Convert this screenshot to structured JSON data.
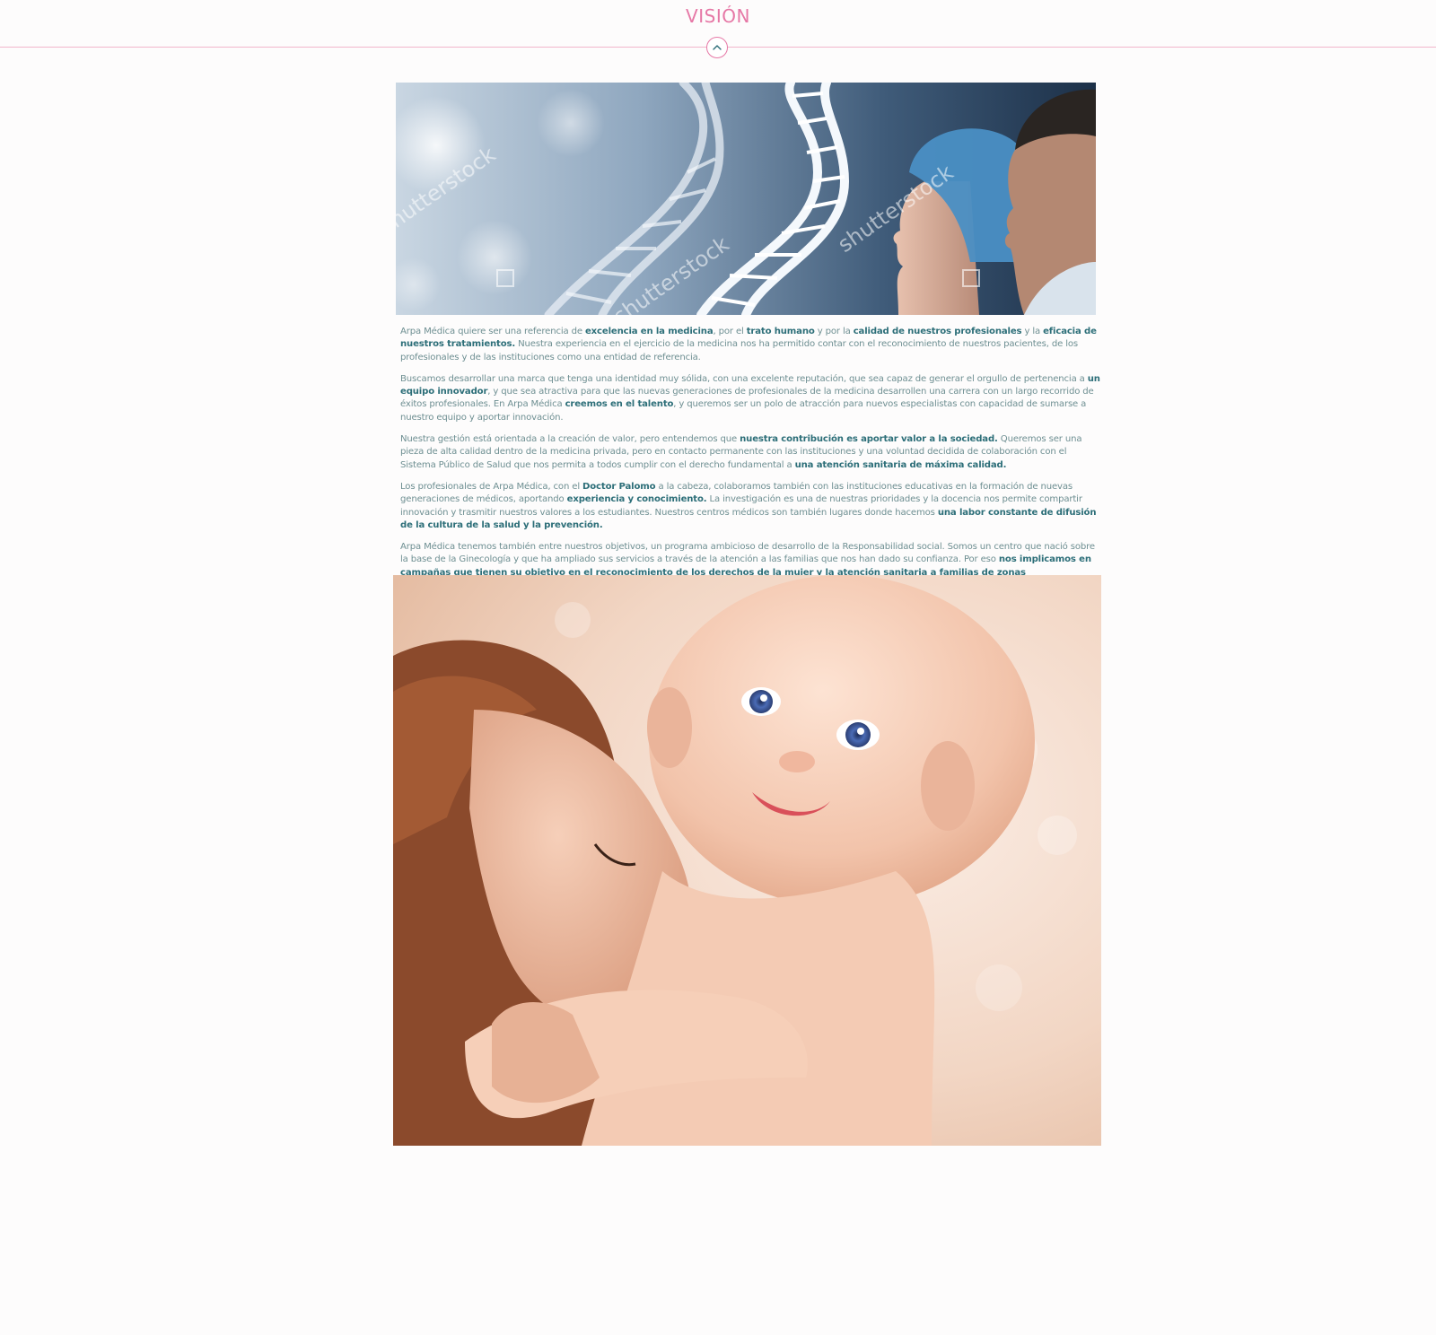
{
  "section": {
    "title": "VISIÓN",
    "collapse_icon": "chevron-up-icon"
  },
  "colors": {
    "title_pink": "#e678a6",
    "divider_pink": "#f2b6cc",
    "text_teal": "#6e8f92",
    "bold_teal": "#2c6e78"
  },
  "banner_image": {
    "subject": "DNA helix with medical professionals",
    "watermark": "shutterstock"
  },
  "family_image": {
    "subject": "mother hugging smiling baby"
  },
  "paragraphs": [
    [
      {
        "t": "Arpa Médica quiere ser una referencia de "
      },
      {
        "t": "excelencia en la medicina",
        "b": true
      },
      {
        "t": ", por el "
      },
      {
        "t": "trato humano",
        "b": true
      },
      {
        "t": " y por la "
      },
      {
        "t": "calidad de nuestros profesionales",
        "b": true
      },
      {
        "t": " y la "
      },
      {
        "t": "eficacia de nuestros tratamientos.",
        "b": true
      },
      {
        "t": " Nuestra experiencia en el ejercicio de la medicina nos ha permitido contar con el reconocimiento de nuestros pacientes, de los profesionales y de las instituciones como una entidad de referencia."
      }
    ],
    [
      {
        "t": "Buscamos desarrollar una marca que tenga una identidad muy sólida, con una excelente reputación, que sea capaz de generar el orgullo de pertenencia a "
      },
      {
        "t": "un equipo innovador",
        "b": true
      },
      {
        "t": ", y que sea atractiva para que las nuevas generaciones de profesionales de la medicina desarrollen una carrera con un largo recorrido de éxitos profesionales. En Arpa Médica "
      },
      {
        "t": "creemos en el talento",
        "b": true
      },
      {
        "t": ", y queremos ser un polo de atracción para nuevos especialistas con capacidad de sumarse a nuestro equipo y aportar innovación."
      }
    ],
    [
      {
        "t": "Nuestra gestión está orientada a la creación de valor, pero entendemos que "
      },
      {
        "t": "nuestra contribución es aportar valor a la sociedad.",
        "b": true
      },
      {
        "t": " Queremos ser una pieza de alta calidad dentro de la medicina privada, pero en contacto permanente con las instituciones y una voluntad decidida de colaboración con el Sistema Público de Salud que nos permita a todos cumplir con el derecho fundamental a "
      },
      {
        "t": "una atención sanitaria de máxima calidad.",
        "b": true
      }
    ],
    [
      {
        "t": "Los profesionales de Arpa Médica, con el "
      },
      {
        "t": "Doctor Palomo",
        "b": true
      },
      {
        "t": " a la cabeza, colaboramos también con las instituciones educativas en la formación de nuevas generaciones de médicos, aportando "
      },
      {
        "t": "experiencia y conocimiento.",
        "b": true
      },
      {
        "t": " La investigación es una de nuestras prioridades y la docencia nos permite compartir innovación y trasmitir nuestros valores a los estudiantes. Nuestros centros médicos son también lugares donde hacemos "
      },
      {
        "t": "una labor constante de difusión de la cultura de la salud y la prevención.",
        "b": true
      }
    ],
    [
      {
        "t": "Arpa Médica tenemos también entre nuestros objetivos, un programa ambicioso de desarrollo de la Responsabilidad social. Somos un centro que nació sobre la base de la Ginecología y que ha ampliado sus servicios a través de la atención a las familias que nos han dado su confianza. Por eso "
      },
      {
        "t": "nos implicamos en campañas que tienen su objetivo en el reconocimiento de los derechos de la mujer y la atención sanitaria a familias de zonas desfavorecidas.",
        "b": true
      }
    ]
  ]
}
